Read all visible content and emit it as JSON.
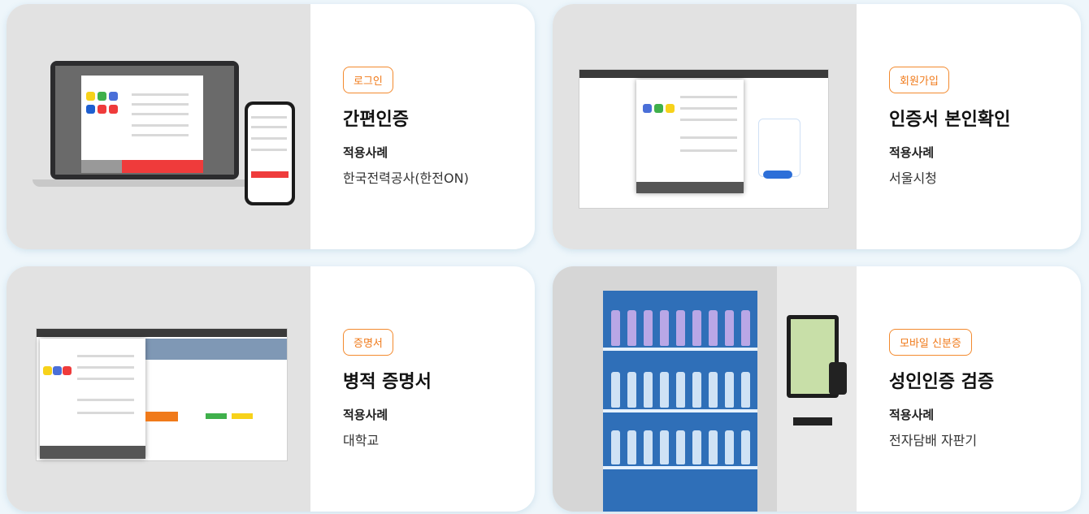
{
  "cards": [
    {
      "badge": "로그인",
      "title": "간편인증",
      "case_label": "적용사례",
      "case_value": "한국전력공사(한전ON)"
    },
    {
      "badge": "회원가입",
      "title": "인증서 본인확인",
      "case_label": "적용사례",
      "case_value": "서울시청"
    },
    {
      "badge": "증명서",
      "title": "병적 증명서",
      "case_label": "적용사례",
      "case_value": "대학교"
    },
    {
      "badge": "모바일 신분증",
      "title": "성인인증 검증",
      "case_label": "적용사례",
      "case_value": "전자담배 자판기"
    }
  ],
  "colors": {
    "accent": "#f07a1a",
    "background": "#eef6fb",
    "card": "#ffffff",
    "media": "#e2e2e2"
  }
}
